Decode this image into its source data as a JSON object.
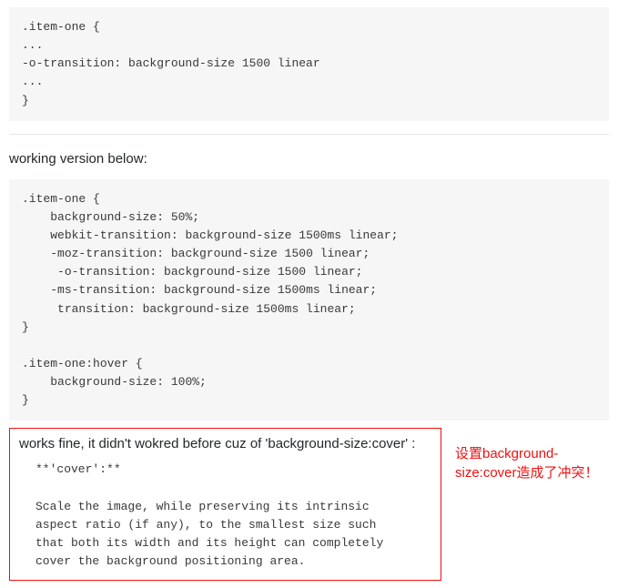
{
  "code_block_1": ".item-one {\n...\n-o-transition: background-size 1500 linear\n...\n}",
  "intro_text": "working version below:",
  "code_block_2": ".item-one {\n    background-size: 50%;\n    webkit-transition: background-size 1500ms linear;\n    -moz-transition: background-size 1500 linear;\n     -o-transition: background-size 1500 linear;\n    -ms-transition: background-size 1500ms linear;\n     transition: background-size 1500ms linear;\n}\n\n.item-one:hover {\n    background-size: 100%;\n}",
  "red_box": {
    "lead": "works fine, it didn't wokred before cuz of 'background-size:cover' :",
    "quote": "**'cover':**\n\nScale the image, while preserving its intrinsic\naspect ratio (if any), to the smallest size such\nthat both its width and its height can completely\ncover the background positioning area."
  },
  "side_note": "设置background-size:cover造成了冲突！"
}
